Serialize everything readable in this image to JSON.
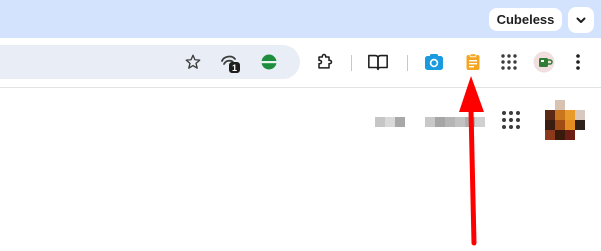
{
  "titlebar": {
    "profile_name": "Cubeless",
    "tab_menu_icon": "chevron-down-icon"
  },
  "toolbar": {
    "icons": [
      "star-icon",
      "extension-badge-icon",
      "green-circle-extension-icon",
      "puzzle-icon",
      "reading-list-icon",
      "camera-extension-icon",
      "notes-extension-icon",
      "apps-grid-icon",
      "profile-avatar",
      "more-menu-icon"
    ],
    "badge_count": "1"
  },
  "annotation": {
    "arrow_color": "#ff0000"
  },
  "colors": {
    "titlebar_bg": "#d3e3fd",
    "omnibox_bg": "#e9eef6",
    "camera_blue": "#1a9be0",
    "notes_orange": "#f4a623"
  }
}
